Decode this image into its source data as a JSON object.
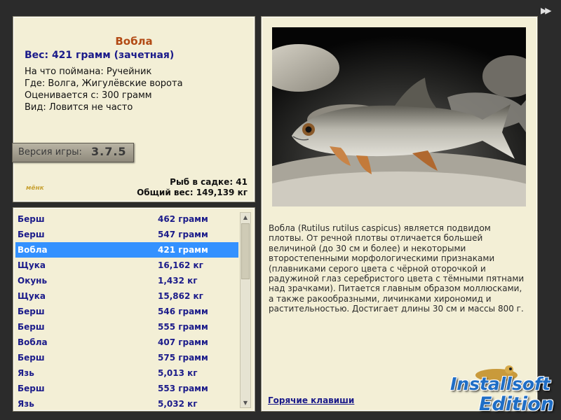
{
  "info": {
    "fish_name": "Вобла",
    "weight_line": "Вес: 421 грамм (зачетная)",
    "caught_with": "На что поймана: Ручейник",
    "location": "Где: Волга, Жигулёвские ворота",
    "valued_from": "Оценивается с: 300 грамм",
    "kind": "Вид: Ловится не часто",
    "version_label": "Версия игры:",
    "version_number": "3.7.5",
    "logo_text": "мёнк",
    "fish_in_keepnet": "Рыб в садке: 41",
    "total_weight": "Общий вес: 149,139 кг"
  },
  "catch_list": [
    {
      "name": "Берш",
      "weight": "462 грамм"
    },
    {
      "name": "Берш",
      "weight": "547 грамм"
    },
    {
      "name": "Вобла",
      "weight": "421 грамм",
      "selected": true
    },
    {
      "name": "Щука",
      "weight": "16,162 кг"
    },
    {
      "name": "Окунь",
      "weight": "1,432 кг"
    },
    {
      "name": "Щука",
      "weight": "15,862 кг"
    },
    {
      "name": "Берш",
      "weight": "546 грамм"
    },
    {
      "name": "Берш",
      "weight": "555 грамм"
    },
    {
      "name": "Вобла",
      "weight": "407 грамм"
    },
    {
      "name": "Берш",
      "weight": "575 грамм"
    },
    {
      "name": "Язь",
      "weight": "5,013 кг"
    },
    {
      "name": "Берш",
      "weight": "553 грамм"
    },
    {
      "name": "Язь",
      "weight": "5,032 кг"
    }
  ],
  "description": {
    "text": "Вобла (Rutilus rutilus caspicus) является подвидом плотвы. От речной плотвы отличается большей величиной (до 30 см и более) и некоторыми второстепенными морфологическими признаками (плавниками серого цвета с чёрной оторочкой и радужиной глаз серебристого цвета с тёмными пятнами над зрачками). Питается главным образом моллюсками, а также ракообразными, личинками хирономид и растительностью. Достигает длины 30 см и массы 800 г.",
    "hotkeys_link": "Горячие клавиши"
  },
  "watermark": {
    "line1": "Installsoft",
    "line2": "Edition"
  },
  "colors": {
    "panel_bg": "#f3efd6",
    "selection": "#3391ff",
    "title_orange": "#b24a15",
    "text_navy": "#1b1b8a"
  },
  "icons": {
    "fast_forward": "fast-forward-icon"
  }
}
